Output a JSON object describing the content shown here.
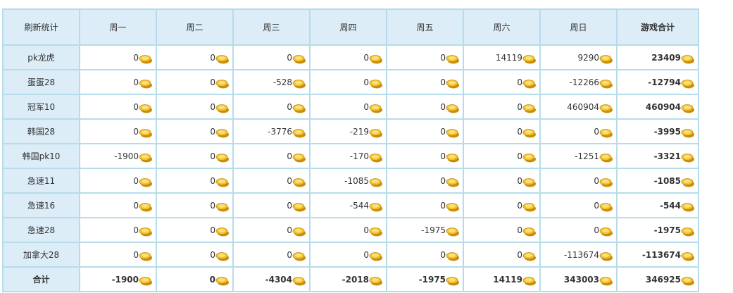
{
  "table": {
    "header": [
      "刷新统计",
      "周一",
      "周二",
      "周三",
      "周四",
      "周五",
      "周六",
      "周日",
      "游戏合计"
    ],
    "rows": [
      {
        "name": "pk龙虎",
        "values": [
          "0",
          "0",
          "0",
          "0",
          "0",
          "14119",
          "9290"
        ],
        "total": "23409"
      },
      {
        "name": "蛋蛋28",
        "values": [
          "0",
          "0",
          "-528",
          "0",
          "0",
          "0",
          "-12266"
        ],
        "total": "-12794"
      },
      {
        "name": "冠军10",
        "values": [
          "0",
          "0",
          "0",
          "0",
          "0",
          "0",
          "460904"
        ],
        "total": "460904"
      },
      {
        "name": "韩国28",
        "values": [
          "0",
          "0",
          "-3776",
          "-219",
          "0",
          "0",
          "0"
        ],
        "total": "-3995"
      },
      {
        "name": "韩国pk10",
        "values": [
          "-1900",
          "0",
          "0",
          "-170",
          "0",
          "0",
          "-1251"
        ],
        "total": "-3321"
      },
      {
        "name": "急速11",
        "values": [
          "0",
          "0",
          "0",
          "-1085",
          "0",
          "0",
          "0"
        ],
        "total": "-1085"
      },
      {
        "name": "急速16",
        "values": [
          "0",
          "0",
          "0",
          "-544",
          "0",
          "0",
          "0"
        ],
        "total": "-544"
      },
      {
        "name": "急速28",
        "values": [
          "0",
          "0",
          "0",
          "0",
          "-1975",
          "0",
          "0"
        ],
        "total": "-1975"
      },
      {
        "name": "加拿大28",
        "values": [
          "0",
          "0",
          "0",
          "0",
          "0",
          "0",
          "-113674"
        ],
        "total": "-113674"
      }
    ],
    "summary": {
      "name": "合计",
      "values": [
        "-1900",
        "0",
        "-4304",
        "-2018",
        "-1975",
        "14119",
        "343003"
      ],
      "total": "346925"
    }
  },
  "icons": {
    "cell_icon": "gold-coin-icon"
  },
  "colors": {
    "border": "#b5dceb",
    "header_bg": "#ddedf7",
    "coin_gold": "#f2c12e",
    "coin_dark": "#c98e0b"
  }
}
